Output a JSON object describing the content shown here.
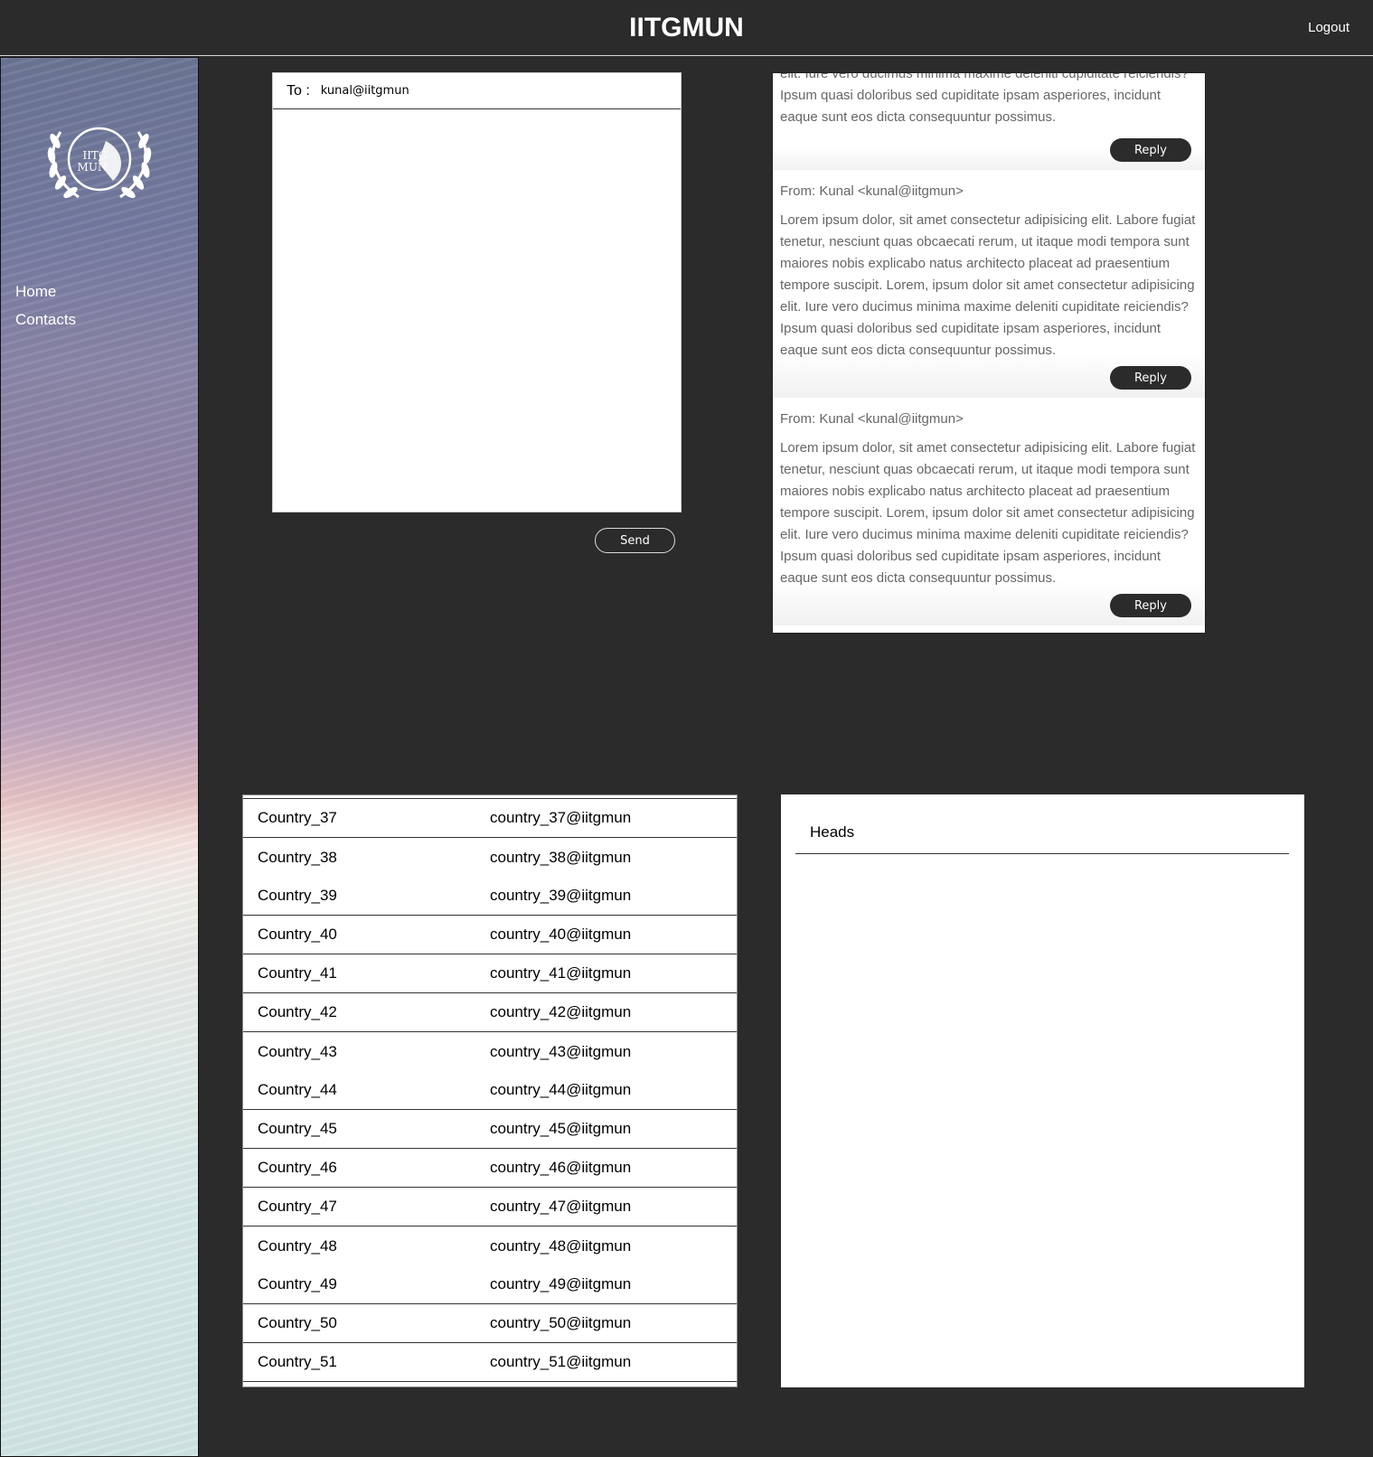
{
  "header": {
    "title": "IITGMUN",
    "logout_label": "Logout"
  },
  "sidebar": {
    "logo_text_line1": "IITG",
    "logo_text_line2": "MUN",
    "items": [
      {
        "label": "Home"
      },
      {
        "label": "Contacts"
      }
    ]
  },
  "compose": {
    "to_label": "To :",
    "to_value": "kunal@iitgmun",
    "body_value": "",
    "send_label": "Send"
  },
  "inbox": {
    "first_partial_body": "elit. Iure vero ducimus minima maxime deleniti cupiditate reiciendis? Ipsum quasi doloribus sed cupiditate ipsam asperiores, incidunt eaque sunt eos dicta consequuntur possimus.",
    "messages": [
      {
        "from": "From: Kunal <kunal@iitgmun>",
        "body": "Lorem ipsum dolor, sit amet consectetur adipisicing elit. Labore fugiat tenetur, nesciunt quas obcaecati rerum, ut itaque modi tempora sunt maiores nobis explicabo natus architecto placeat ad praesentium tempore suscipit. Lorem, ipsum dolor sit amet consectetur adipisicing elit. Iure vero ducimus minima maxime deleniti cupiditate reiciendis? Ipsum quasi doloribus sed cupiditate ipsam asperiores, incidunt eaque sunt eos dicta consequuntur possimus."
      },
      {
        "from": "From: Kunal <kunal@iitgmun>",
        "body": "Lorem ipsum dolor, sit amet consectetur adipisicing elit. Labore fugiat tenetur, nesciunt quas obcaecati rerum, ut itaque modi tempora sunt maiores nobis explicabo natus architecto placeat ad praesentium tempore suscipit. Lorem, ipsum dolor sit amet consectetur adipisicing elit. Iure vero ducimus minima maxime deleniti cupiditate reiciendis? Ipsum quasi doloribus sed cupiditate ipsam asperiores, incidunt eaque sunt eos dicta consequuntur possimus."
      }
    ],
    "reply_label": "Reply"
  },
  "contacts": {
    "rows": [
      {
        "name": "Country_37",
        "email": "country_37@iitgmun"
      },
      {
        "name": "Country_38",
        "email": "country_38@iitgmun"
      },
      {
        "name": "Country_39",
        "email": "country_39@iitgmun"
      },
      {
        "name": "Country_40",
        "email": "country_40@iitgmun"
      },
      {
        "name": "Country_41",
        "email": "country_41@iitgmun"
      },
      {
        "name": "Country_42",
        "email": "country_42@iitgmun"
      },
      {
        "name": "Country_43",
        "email": "country_43@iitgmun"
      },
      {
        "name": "Country_44",
        "email": "country_44@iitgmun"
      },
      {
        "name": "Country_45",
        "email": "country_45@iitgmun"
      },
      {
        "name": "Country_46",
        "email": "country_46@iitgmun"
      },
      {
        "name": "Country_47",
        "email": "country_47@iitgmun"
      },
      {
        "name": "Country_48",
        "email": "country_48@iitgmun"
      },
      {
        "name": "Country_49",
        "email": "country_49@iitgmun"
      },
      {
        "name": "Country_50",
        "email": "country_50@iitgmun"
      },
      {
        "name": "Country_51",
        "email": "country_51@iitgmun"
      }
    ]
  },
  "heads": {
    "title": "Heads"
  },
  "colors": {
    "background": "#2b2b2b",
    "panel": "#ffffff",
    "button": "#2b2b2b",
    "message_text": "#666666"
  }
}
